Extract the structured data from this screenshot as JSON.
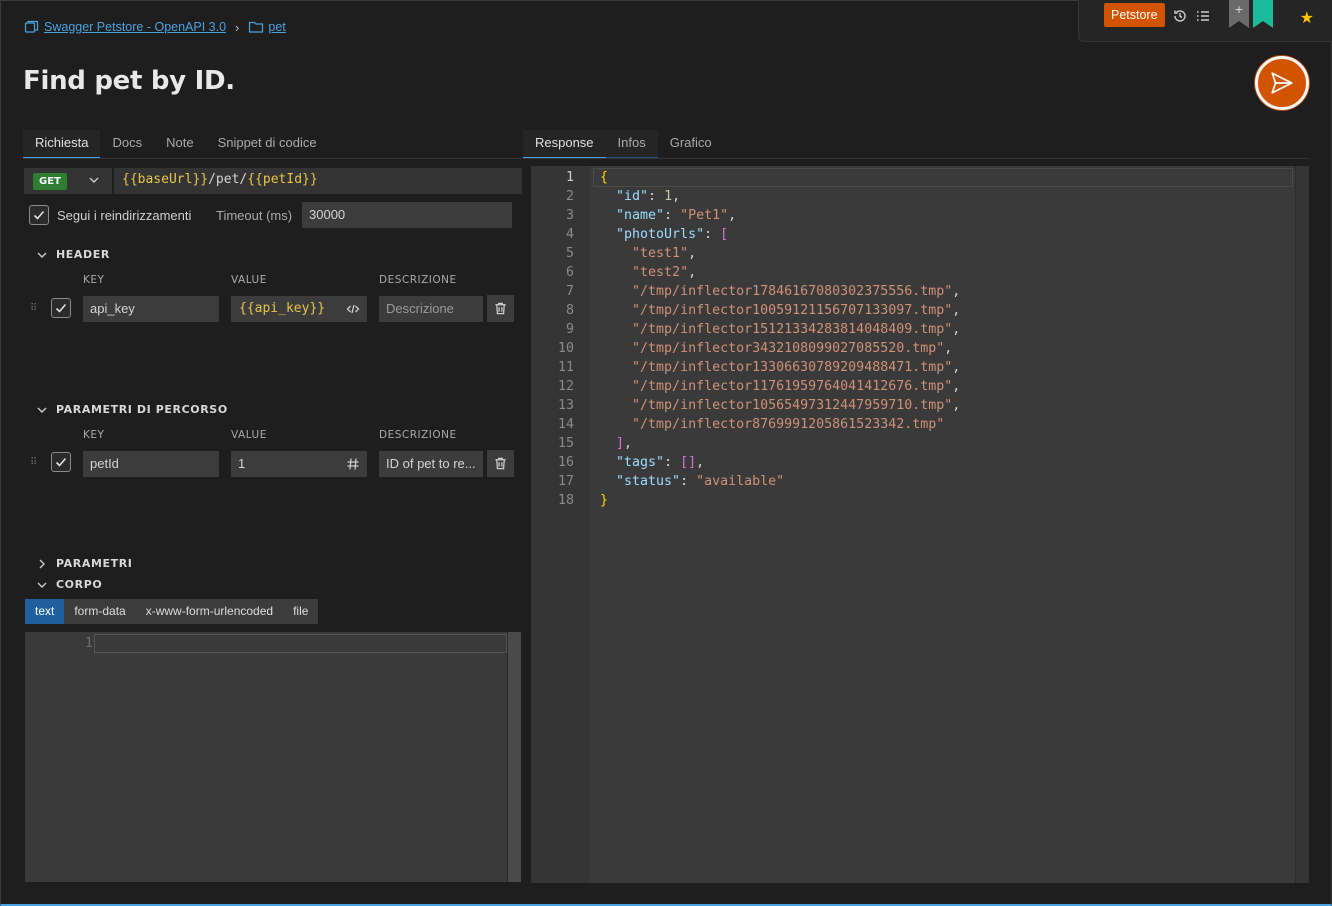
{
  "topbar": {
    "environment": "Petstore",
    "icons": [
      "history-icon",
      "list-icon",
      "bookmark-gray-icon",
      "bookmark-teal-icon",
      "star-icon"
    ],
    "add_symbol": "+"
  },
  "breadcrumb": {
    "collection": "Swagger Petstore - OpenAPI 3.0",
    "separator": "›",
    "folder": "pet"
  },
  "title": "Find pet by ID.",
  "request_tabs": [
    "Richiesta",
    "Docs",
    "Note",
    "Snippet di codice"
  ],
  "response_tabs": [
    "Response",
    "Infos",
    "Grafico"
  ],
  "request": {
    "method": "GET",
    "url_parts": [
      {
        "text": "{{baseUrl}}",
        "var": true
      },
      {
        "text": "/pet/",
        "var": false
      },
      {
        "text": "{{petId}}",
        "var": true
      }
    ],
    "follow_redirects_label": "Segui i reindirizzamenti",
    "timeout_label": "Timeout (ms)",
    "timeout_value": "30000"
  },
  "header_section": {
    "title": "HEADER",
    "columns": {
      "key": "KEY",
      "value": "VALUE",
      "description": "DESCRIZIONE"
    },
    "rows": [
      {
        "key": "api_key",
        "value": "{{api_key}}",
        "description_placeholder": "Descrizione"
      }
    ]
  },
  "path_section": {
    "title": "PARAMETRI DI PERCORSO",
    "columns": {
      "key": "KEY",
      "value": "VALUE",
      "description": "DESCRIZIONE"
    },
    "rows": [
      {
        "key": "petId",
        "value": "1",
        "description": "ID of pet to re..."
      }
    ]
  },
  "params_section": {
    "title": "PARAMETRI"
  },
  "body_section": {
    "title": "CORPO",
    "tabs": [
      "text",
      "form-data",
      "x-www-form-urlencoded",
      "file"
    ],
    "active_tab": "text",
    "line_number": "1"
  },
  "response": {
    "line_numbers": [
      "1",
      "2",
      "3",
      "4",
      "5",
      "6",
      "7",
      "8",
      "9",
      "10",
      "11",
      "12",
      "13",
      "14",
      "15",
      "16",
      "17",
      "18"
    ],
    "json": {
      "id": 1,
      "name": "Pet1",
      "photoUrls": [
        "test1",
        "test2",
        "/tmp/inflector1784616708030237555​6.tmp",
        "/tmp/inflector1005912115670713309​7.tmp",
        "/tmp/inflector1512133428381404840​9.tmp",
        "/tmp/inflector3432108099027085520.tmp",
        "/tmp/inflector1330663078920948847​1.tmp",
        "/tmp/inflector1176195976404141267​6.tmp",
        "/tmp/inflector1056549731244795971​0.tmp",
        "/tmp/inflector876999120586152334​2.tmp"
      ],
      "tags": [],
      "status": "available"
    }
  },
  "colors": {
    "accent": "#4aa3df",
    "brand": "#d35400",
    "method_get": "#2e7d32",
    "variable": "#e8c547",
    "bookmark_teal": "#1abc9c"
  }
}
